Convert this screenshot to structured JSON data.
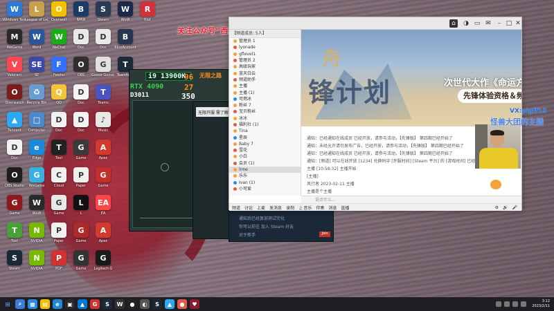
{
  "promo_text": "关注公众号“西游网游戏中心”回复“pigff”领1000",
  "desktop_icons": [
    {
      "label": "Windows Terminal",
      "color": "#2b7bd6",
      "glyph": "W"
    },
    {
      "label": "League of Legends",
      "color": "#c8a04a",
      "glyph": "L"
    },
    {
      "label": "Overwolf",
      "color": "#f2c200",
      "glyph": "O"
    },
    {
      "label": "BMW",
      "color": "#1b3a66",
      "glyph": "B"
    },
    {
      "label": "Steam",
      "color": "#2a3c55",
      "glyph": "S"
    },
    {
      "label": "WoW",
      "color": "#1c2a4a",
      "glyph": "W"
    },
    {
      "label": "Riot",
      "color": "#d13239",
      "glyph": "R"
    },
    {
      "label": "WeGame",
      "color": "#2a2a2a",
      "glyph": "M"
    },
    {
      "label": "Word",
      "color": "#2b579a",
      "glyph": "W"
    },
    {
      "label": "WeChat",
      "color": "#1aad19",
      "glyph": "W"
    },
    {
      "label": "Doc",
      "color": "#e8e8e8",
      "glyph": "D"
    },
    {
      "label": "Doc",
      "color": "#e8e8e8",
      "glyph": "D"
    },
    {
      "label": "BlizzAccount",
      "color": "#253850",
      "glyph": "B"
    },
    {
      "label": "Valorant",
      "color": "#ff4655",
      "glyph": "V"
    },
    {
      "label": "SE",
      "color": "#3a4aa6",
      "glyph": "SE"
    },
    {
      "label": "Feishu",
      "color": "#3370ff",
      "glyph": "F"
    },
    {
      "label": "OBS",
      "color": "#302e31",
      "glyph": "O"
    },
    {
      "label": "Goose Goose Duck",
      "color": "#e0e0e0",
      "glyph": "G"
    },
    {
      "label": "Teamfight",
      "color": "#1a2c3a",
      "glyph": "T"
    },
    {
      "label": "Overwatch",
      "color": "#7a1d1d",
      "glyph": "O"
    },
    {
      "label": "Recycle Bin",
      "color": "#6a9bd1",
      "glyph": "♻"
    },
    {
      "label": "QQ",
      "color": "#f5c33b",
      "glyph": "Q"
    },
    {
      "label": "Doc",
      "color": "#f4f4f4",
      "glyph": "D"
    },
    {
      "label": "Teams",
      "color": "#4b53bc",
      "glyph": "T"
    },
    {
      "label": "Tencent",
      "color": "#2aa8f2",
      "glyph": "▲"
    },
    {
      "label": "Computer",
      "color": "#4d88c8",
      "glyph": "□"
    },
    {
      "label": "Doc",
      "color": "#f2f2f2",
      "glyph": "D"
    },
    {
      "label": "Doc",
      "color": "#f2f2f2",
      "glyph": "D"
    },
    {
      "label": "Music",
      "color": "#e8e8e8",
      "glyph": "♪"
    },
    {
      "label": "Doc",
      "color": "#f2f2f2",
      "glyph": "D"
    },
    {
      "label": "Edge",
      "color": "#1c8ad9",
      "glyph": "e"
    },
    {
      "label": "Tool",
      "color": "#222",
      "glyph": "T"
    },
    {
      "label": "Game",
      "color": "#3a3a3a",
      "glyph": "G"
    },
    {
      "label": "Apex",
      "color": "#d13a2c",
      "glyph": "A"
    },
    {
      "label": "OBS Studio",
      "color": "#1e1e1e",
      "glyph": "O"
    },
    {
      "label": "WeGame",
      "color": "#3ab0e0",
      "glyph": "G"
    },
    {
      "label": "Cloud",
      "color": "#f0f0f0",
      "glyph": "C"
    },
    {
      "label": "Paper",
      "color": "#f0f0f0",
      "glyph": "P"
    },
    {
      "label": "Game",
      "color": "#c0302a",
      "glyph": "G"
    },
    {
      "label": "Game",
      "color": "#8e1b1b",
      "glyph": "G"
    },
    {
      "label": "WoW",
      "color": "#2a2a2a",
      "glyph": "W"
    },
    {
      "label": "Game",
      "color": "#e8e8e8",
      "glyph": "G"
    },
    {
      "label": "L",
      "color": "#111",
      "glyph": "L"
    },
    {
      "label": "EA",
      "color": "#ff4747",
      "glyph": "EA"
    },
    {
      "label": "Tool",
      "color": "#4a9f3a",
      "glyph": "T"
    },
    {
      "label": "NVIDIA",
      "color": "#76b900",
      "glyph": "N"
    },
    {
      "label": "Paper",
      "color": "#f0f0f0",
      "glyph": "P"
    },
    {
      "label": "Game",
      "color": "#ad2a2a",
      "glyph": "G"
    },
    {
      "label": "Apex",
      "color": "#d13a2c",
      "glyph": "A"
    },
    {
      "label": "Steam",
      "color": "#1b2838",
      "glyph": "S"
    },
    {
      "label": "NVIDIA",
      "color": "#76b900",
      "glyph": "N"
    },
    {
      "label": "PDF",
      "color": "#d13232",
      "glyph": "P"
    },
    {
      "label": "Game",
      "color": "#333",
      "glyph": "G"
    },
    {
      "label": "Logitech G",
      "color": "#1a1a1a",
      "glyph": "G"
    },
    {
      "label": "Tool",
      "color": "#2a6ab8",
      "glyph": "T"
    },
    {
      "label": "Doc",
      "color": "#f2f2f2",
      "glyph": "D"
    }
  ],
  "hw": {
    "cpu_label": "i9 13900K",
    "gpu_label": "RTX 4090",
    "small": "D3011",
    "val1": "96",
    "val2": "27",
    "val3": "350",
    "game_name": "无限之路"
  },
  "dark_tip": "无限开服 需了解",
  "steam_lines": [
    "通知后已经复部测试完化",
    "你可以前往 加入 Steam 好友",
    "对于新手"
  ],
  "steam_btn": "Join",
  "main_window": {
    "member_header": "【频道成员: 5人】",
    "members": [
      {
        "name": "管理员 1",
        "color": "#f2a13b"
      },
      {
        "name": "lyonade",
        "color": "#e05a4a"
      },
      {
        "name": "gflevel1",
        "color": "#f2a13b"
      },
      {
        "name": "管理员 2",
        "color": "#e05a4a"
      },
      {
        "name": "高级玩家",
        "color": "#f2a13b"
      },
      {
        "name": "蓝天白云",
        "color": "#f2a13b"
      },
      {
        "name": "频道助手",
        "color": "#e05a4a"
      },
      {
        "name": "主播",
        "color": "#f2a13b"
      },
      {
        "name": "主播 (1)",
        "color": "#f2a13b"
      },
      {
        "name": "可燃冰",
        "color": "#2a8ae0"
      },
      {
        "name": "粉丝 7",
        "color": "#f2a13b"
      },
      {
        "name": "宝贝粉丝",
        "color": "#e05a4a"
      },
      {
        "name": "冰冰",
        "color": "#f2a13b"
      },
      {
        "name": "福利社 (1)",
        "color": "#e05a4a"
      },
      {
        "name": "Tina",
        "color": "#f2a13b"
      },
      {
        "name": "星辰",
        "color": "#2a8ae0"
      },
      {
        "name": "Baby 7",
        "color": "#f2a13b"
      },
      {
        "name": "雪花",
        "color": "#e05a4a"
      },
      {
        "name": "小白",
        "color": "#f2a13b"
      },
      {
        "name": "会员 (1)",
        "color": "#e05a4a"
      },
      {
        "name": "lime",
        "color": "#f2a13b"
      },
      {
        "name": "乐乐",
        "color": "#f2a13b"
      },
      {
        "name": "Ivan (1)",
        "color": "#2a8ae0"
      },
      {
        "name": "小可爱",
        "color": "#e05a4a"
      }
    ],
    "headline": "次世代大作《命运方舟》国服先锋启",
    "subline": "先锋体验资格＆频道短位助力超前",
    "chat_lines": [
      "通知：已经通知在线成员 已经开放，请参与活动，【先锋版】 第四期已经开始了",
      "通知：未经允许请勿发布广告，已经开放，请参与活动，【先锋版】 第四期已经开始了",
      "通知：已经通知在线成员 已经开放，请参与活动，【先锋版】 第四期已经开始了",
      "通知：[频道] 可以在线开放 [1234] 兑换码中 [开服时间] [Steam 平台] 的 [游戏时间] 已经结束",
      "主播 [10:58:32] 主播开始",
      "[主播]",
      "风行者 2023-02-11 主播",
      "主播是个主播"
    ],
    "input_placeholder": "说点什么…",
    "toolbar_items": [
      "频道",
      "讨论",
      "上麦",
      "发消息",
      "录制",
      "♫ 音乐",
      "伴奏",
      "消息",
      "直播"
    ],
    "side_text1": "VX:pigff13",
    "side_text2": "怪兽大团的主播"
  },
  "taskbar": {
    "time": "3:12",
    "date": "2023/2/11"
  }
}
